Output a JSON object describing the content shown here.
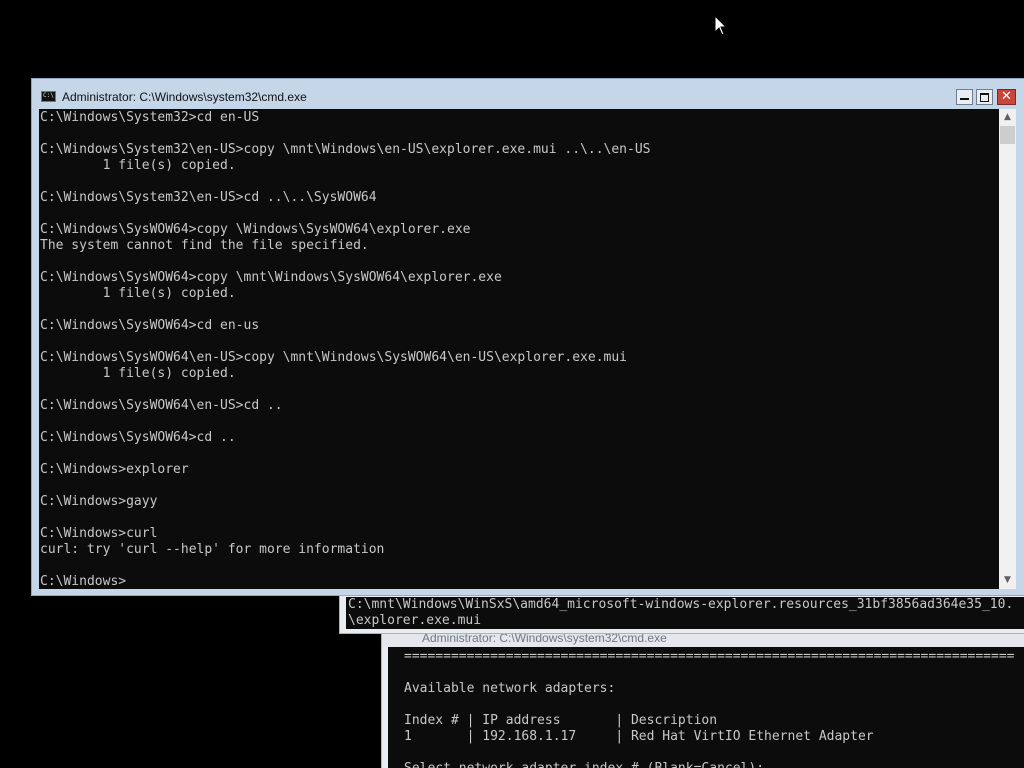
{
  "main_window": {
    "title": "Administrator: C:\\Windows\\system32\\cmd.exe",
    "lines": [
      "C:\\Windows\\System32>cd en-US",
      "",
      "C:\\Windows\\System32\\en-US>copy \\mnt\\Windows\\en-US\\explorer.exe.mui ..\\..\\en-US",
      "        1 file(s) copied.",
      "",
      "C:\\Windows\\System32\\en-US>cd ..\\..\\SysWOW64",
      "",
      "C:\\Windows\\SysWOW64>copy \\Windows\\SysWOW64\\explorer.exe",
      "The system cannot find the file specified.",
      "",
      "C:\\Windows\\SysWOW64>copy \\mnt\\Windows\\SysWOW64\\explorer.exe",
      "        1 file(s) copied.",
      "",
      "C:\\Windows\\SysWOW64>cd en-us",
      "",
      "C:\\Windows\\SysWOW64\\en-US>copy \\mnt\\Windows\\SysWOW64\\en-US\\explorer.exe.mui",
      "        1 file(s) copied.",
      "",
      "C:\\Windows\\SysWOW64\\en-US>cd ..",
      "",
      "C:\\Windows\\SysWOW64>cd ..",
      "",
      "C:\\Windows>explorer",
      "",
      "C:\\Windows>gayy",
      "",
      "C:\\Windows>curl",
      "curl: try 'curl --help' for more information",
      "",
      "C:\\Windows>"
    ]
  },
  "background_window_1": {
    "lines": [
      "C:\\mnt\\Windows\\WinSxS\\amd64_microsoft-windows-explorer.resources_31bf3856ad364e35_10.",
      "\\explorer.exe.mui"
    ]
  },
  "background_window_2": {
    "title": "Administrator: C:\\Windows\\system32\\cmd.exe",
    "lines": [
      "==============================================================================",
      "",
      "Available network adapters:",
      "",
      "Index # | IP address       | Description",
      "1       | 192.168.1.17     | Red Hat VirtIO Ethernet Adapter",
      "",
      "Select network adapter index # (Blank=Cancel):"
    ]
  },
  "icons": {
    "cursor": "mouse-pointer-icon",
    "app": "cmd-icon",
    "minimize": "minimize-icon",
    "maximize": "maximize-icon",
    "close": "close-icon",
    "scroll_up": "scroll-up-arrow-icon",
    "scroll_down": "scroll-down-arrow-icon"
  },
  "colors": {
    "console_bg": "#0c0c0c",
    "console_text": "#c8c8c8",
    "titlebar": "#c5d6e8",
    "close_button": "#c8453a"
  }
}
